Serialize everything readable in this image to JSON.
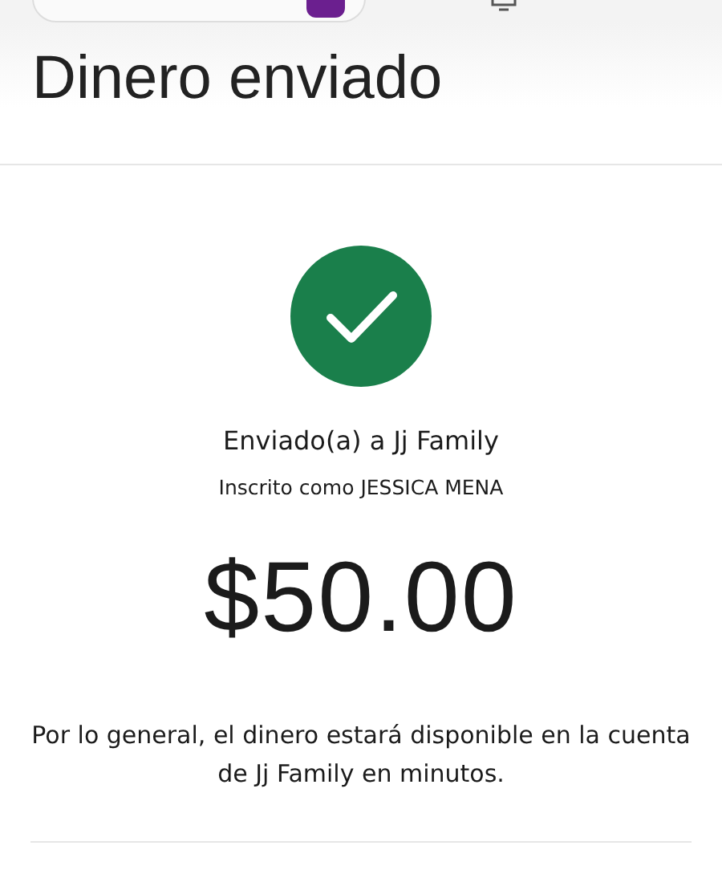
{
  "header": {
    "title": "Dinero enviado"
  },
  "confirmation": {
    "success": true,
    "recipient_line": "Enviado(a) a Jj Family",
    "enrolled_line": "Inscrito como JESSICA MENA",
    "amount": "$50.00",
    "note": "Por lo general, el dinero estará disponible en la cuenta de Jj Family en minutos."
  }
}
